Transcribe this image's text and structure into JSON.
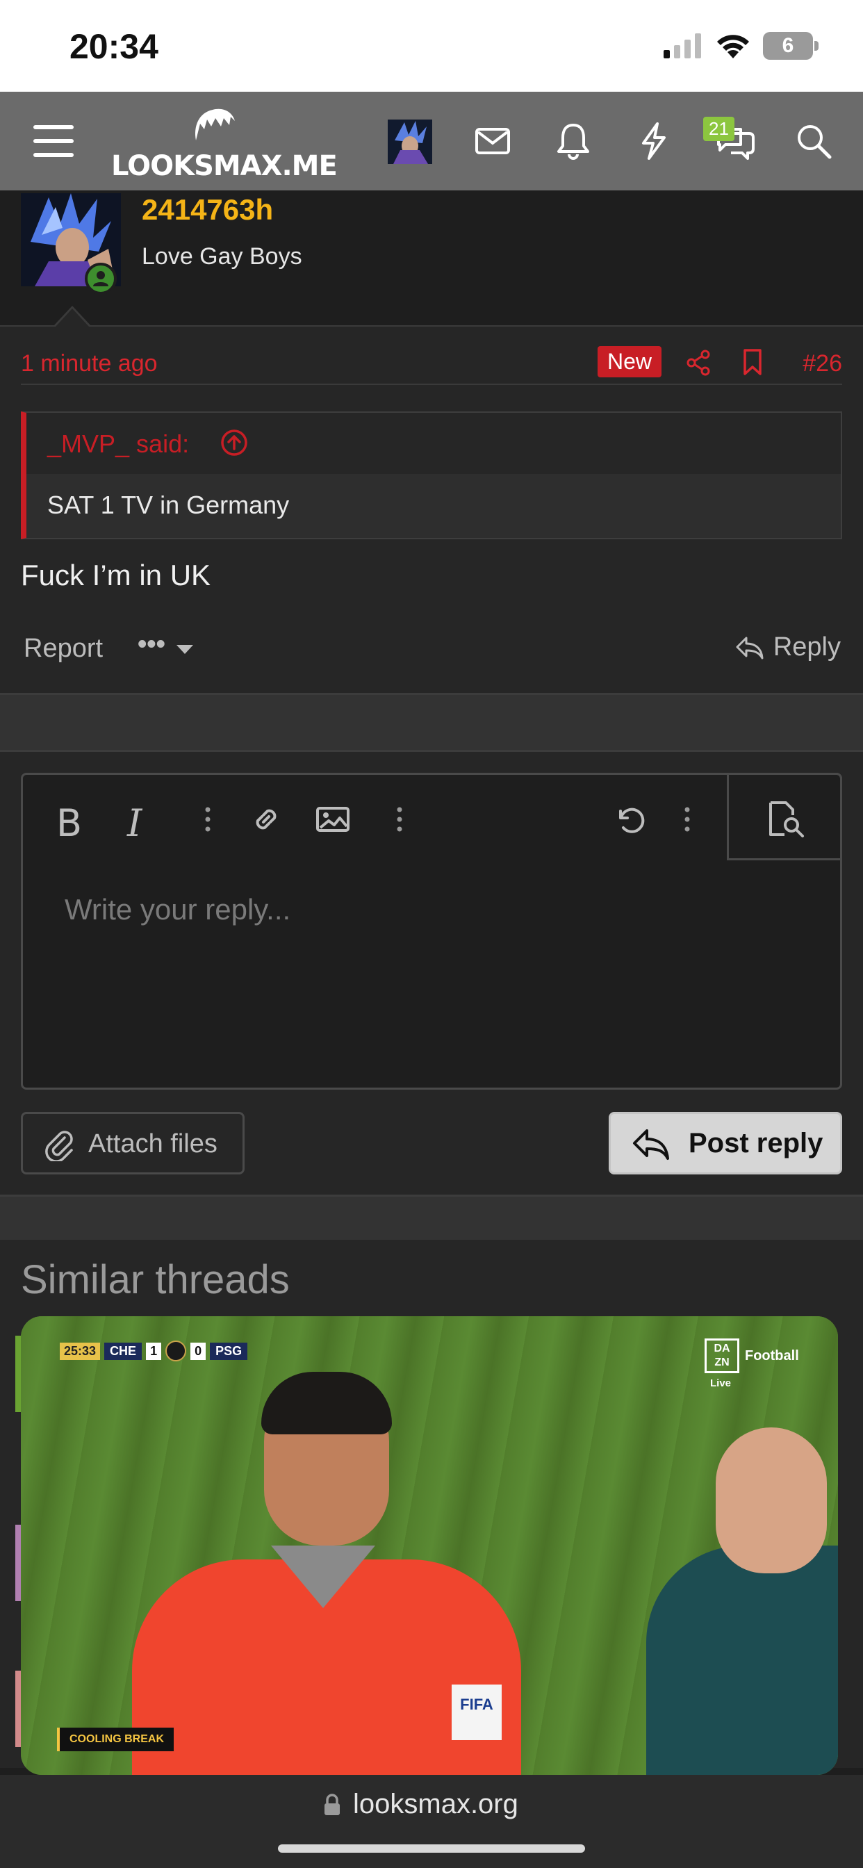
{
  "status": {
    "time": "20:34",
    "battery": "6"
  },
  "nav": {
    "logo": "LOOKSMAX.ME",
    "conversations_badge": "21"
  },
  "post": {
    "author": "2414763h",
    "user_title": "Love Gay Boys",
    "time": "1 minute ago",
    "new_badge": "New",
    "post_number": "#26",
    "quote_author": "_MVP_ said:",
    "quote_text": "SAT 1 TV in Germany",
    "message": "Fuck I’m in UK",
    "report_label": "Report",
    "more_label": "•••",
    "reply_label": "Reply"
  },
  "editor": {
    "bold_label": "B",
    "italic_label": "I",
    "placeholder": "Write your reply...",
    "attach_label": "Attach files",
    "post_label": "Post reply"
  },
  "similar": {
    "title": "Similar threads"
  },
  "video": {
    "clock": "25:33",
    "team_home": "CHE",
    "score_home": "1",
    "score_away": "0",
    "team_away": "PSG",
    "broadcaster_logo": "DA ZN",
    "broadcaster_label": "Football",
    "live_label": "Live",
    "overlay_text": "COOLING BREAK",
    "badge_text": "FIFA"
  },
  "browser": {
    "url": "looksmax.org"
  },
  "colors": {
    "accent_red": "#c81e25",
    "username_gold": "#f5b417",
    "online_green": "#3e8e2e",
    "badge_green": "#8cc63f"
  }
}
